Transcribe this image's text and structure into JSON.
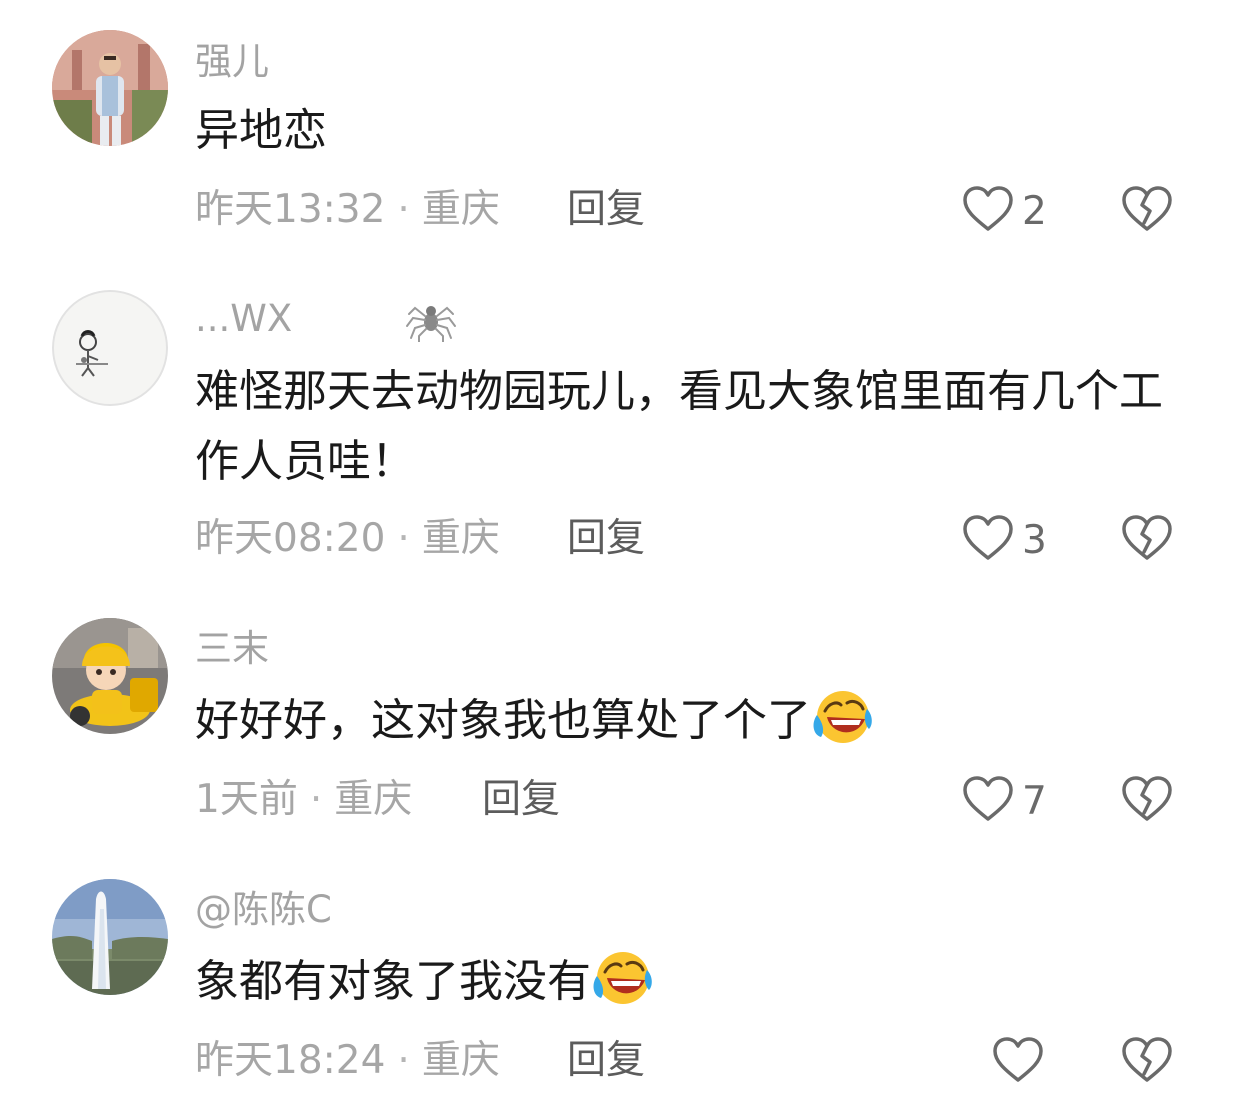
{
  "comments": [
    {
      "username": "强儿",
      "text": "异地恋",
      "time": "昨天13:32",
      "location": "重庆",
      "reply_label": "回复",
      "likes": "2"
    },
    {
      "username": "...WX",
      "badge_icon": "spider-icon",
      "text": "难怪那天去动物园玩儿，看见大象馆里面有几个工作人员哇！",
      "time": "昨天08:20",
      "location": "重庆",
      "reply_label": "回复",
      "likes": "3"
    },
    {
      "username": "三末",
      "text": "好好好，这对象我也算处了个了",
      "emoji": "laughing-crying-emoji",
      "time": "1天前",
      "location": "重庆",
      "reply_label": "回复",
      "likes": "7"
    },
    {
      "username": "@陈陈C",
      "text": "象都有对象了我没有",
      "emoji": "laughing-crying-emoji",
      "time": "昨天18:24",
      "location": "重庆",
      "reply_label": "回复",
      "likes": ""
    }
  ],
  "separator": "·",
  "icons": {
    "like": "heart-outline-icon",
    "dislike": "broken-heart-icon"
  },
  "colors": {
    "username": "#a3a3a3",
    "body_text": "#1a1a1a",
    "meta": "#a6a6a6",
    "reply": "#5c5c5c",
    "icon": "#6a6a6a",
    "emoji_face": "#fbc531"
  }
}
